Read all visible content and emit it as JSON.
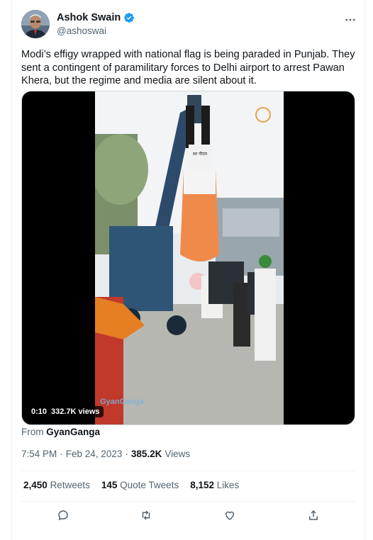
{
  "author": {
    "name": "Ashok Swain",
    "handle": "@ashoswai",
    "verified": true,
    "avatar_icon": "avatar-photo"
  },
  "tweet": {
    "text": "Modi’s effigy wrapped with national flag is being paraded in Punjab. They sent a contingent of paramilitary forces to Delhi airport to arrest Pawan Khera, but the regime and media are silent about it."
  },
  "media": {
    "duration": "0:10",
    "views": "332.7K views",
    "watermark": "GyanGanga",
    "effigy_sign": "सर पीएम"
  },
  "source": {
    "prefix": "From",
    "name": "GyanGanga"
  },
  "meta": {
    "time": "7:54 PM",
    "separator": "·",
    "date": "Feb 24, 2023",
    "views_count": "385.2K",
    "views_label": "Views"
  },
  "stats": {
    "retweets_count": "2,450",
    "retweets_label": "Retweets",
    "quotes_count": "145",
    "quotes_label": "Quote Tweets",
    "likes_count": "8,152",
    "likes_label": "Likes"
  },
  "actions": [
    "reply-icon",
    "retweet-icon",
    "like-icon",
    "share-icon"
  ],
  "colors": {
    "text": "#0f1419",
    "secondary": "#536471",
    "verified": "#1d9bf0",
    "border": "#eff3f4"
  }
}
